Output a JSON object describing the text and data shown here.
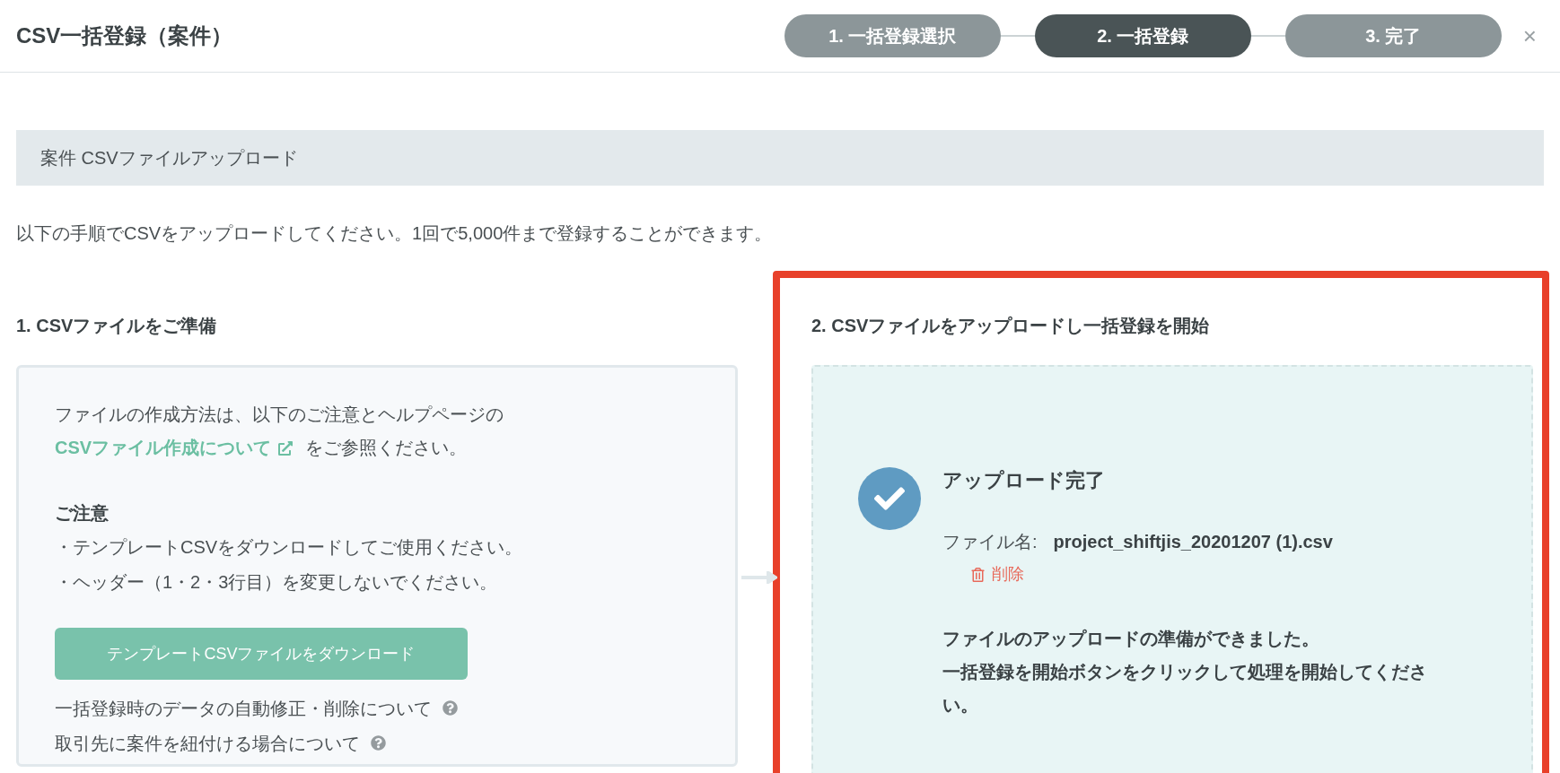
{
  "dialog": {
    "title": "CSV一括登録（案件）",
    "close": "×"
  },
  "steps": [
    {
      "label": "1. 一括登録選択",
      "selected": false
    },
    {
      "label": "2. 一括登録",
      "selected": true
    },
    {
      "label": "3. 完了",
      "selected": false
    }
  ],
  "section_title": "案件 CSVファイルアップロード",
  "description": "以下の手順でCSVをアップロードしてください。1回で5,000件まで登録することができます。",
  "prepare": {
    "heading": "1. CSVファイルをご準備",
    "intro_before": "ファイルの作成方法は、以下のご注意とヘルプページの",
    "link": "CSVファイル作成について",
    "intro_after": "をご参照ください。",
    "notice_title": "ご注意",
    "notices": [
      "・テンプレートCSVをダウンロードしてご使用ください。",
      "・ヘッダー（1・2・3行目）を変更しないでください。"
    ],
    "download_button": "テンプレートCSVファイルをダウンロード",
    "help_links": [
      "一括登録時のデータの自動修正・削除について",
      "取引先に案件を紐付ける場合について"
    ]
  },
  "upload": {
    "heading": "2. CSVファイルをアップロードし一括登録を開始",
    "status": "アップロード完了",
    "file_label": "ファイル名:",
    "file_name": "project_shiftjis_20201207 (1).csv",
    "delete": "削除",
    "messages": [
      "ファイルのアップロードの準備ができました。",
      "一括登録を開始ボタンをクリックして処理を開始してください。"
    ]
  }
}
